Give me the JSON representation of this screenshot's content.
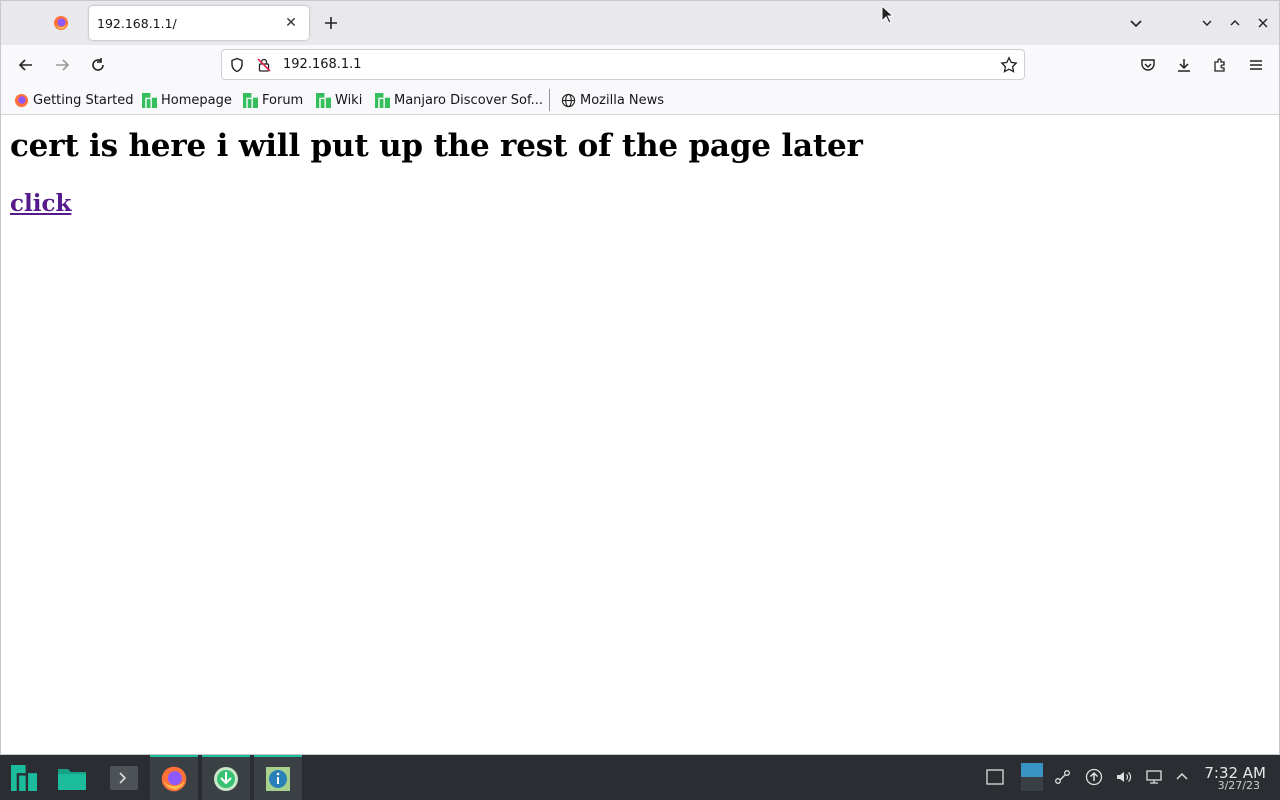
{
  "browser": {
    "tab_title": "192.168.1.1/",
    "url": "192.168.1.1",
    "icons": {
      "back": "arrow-left",
      "forward": "arrow-right",
      "reload": "reload",
      "shield": "tracking-shield",
      "insecure": "insecure-lock",
      "bookmark_star": "star",
      "pocket": "pocket",
      "downloads": "download-arrow",
      "extensions": "puzzle",
      "menu": "hamburger"
    }
  },
  "bookmarks": [
    {
      "label": "Getting Started",
      "icon": "firefox-icon"
    },
    {
      "label": "Homepage",
      "icon": "manjaro-icon"
    },
    {
      "label": "Forum",
      "icon": "manjaro-icon"
    },
    {
      "label": "Wiki",
      "icon": "manjaro-icon"
    },
    {
      "label": "Manjaro Discover Sof...",
      "icon": "manjaro-icon"
    },
    {
      "label": "Mozilla News",
      "icon": "globe-icon"
    }
  ],
  "page": {
    "heading": "cert is here i will put up the rest of the page later",
    "link_text": "click"
  },
  "taskbar": {
    "time": "7:32 AM",
    "date": "3/27/23"
  },
  "colors": {
    "accent": "#1abc9c",
    "visited_link": "#551a8b",
    "taskbar_bg": "#2a2e32"
  }
}
